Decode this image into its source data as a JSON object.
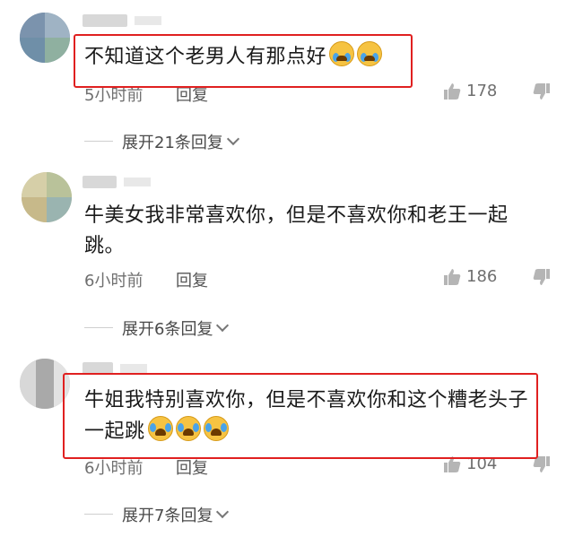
{
  "comments": [
    {
      "text": "不知道这个老男人有那点好",
      "emoji": [
        "crying-face",
        "crying-face"
      ],
      "time": "5小时前",
      "reply_label": "回复",
      "likes": "178",
      "expand_label": "展开21条回复",
      "highlighted": true
    },
    {
      "text_line1": "牛美女我非常喜欢你，但是不喜欢你和老王一起",
      "text_line2": "跳。",
      "time": "6小时前",
      "reply_label": "回复",
      "likes": "186",
      "expand_label": "展开6条回复",
      "highlighted": false
    },
    {
      "text_line1": "牛姐我特别喜欢你，但是不喜欢你和这个糟老头子",
      "text_line2": "一起跳",
      "emoji": [
        "laughing-tears-face",
        "laughing-tears-face",
        "laughing-tears-face"
      ],
      "time": "6小时前",
      "reply_label": "回复",
      "likes": "104",
      "expand_label": "展开7条回复",
      "highlighted": true
    }
  ],
  "colors": {
    "highlight": "#e02020",
    "meta": "#6f6f6f"
  },
  "icons": {
    "like": "thumbs-up-icon",
    "dislike": "thumbs-down-icon",
    "expand": "chevron-down-icon"
  }
}
